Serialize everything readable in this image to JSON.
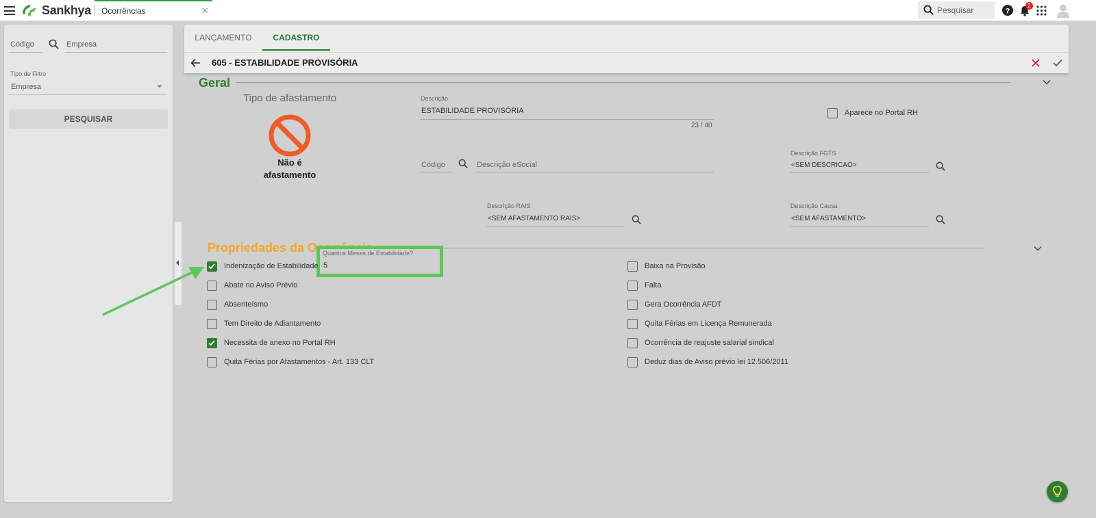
{
  "app": {
    "brand": "Sankhya",
    "tab_title": "Ocorrências",
    "search_placeholder": "Pesquisar",
    "notification_count": "2"
  },
  "left_panel": {
    "codigo_label": "Código",
    "empresa_label": "Empresa",
    "tipo_filtro_label": "Tipo de Filtro",
    "tipo_filtro_value": "Empresa",
    "pesquisar_label": "PESQUISAR"
  },
  "tabs": [
    {
      "label": "LANÇAMENTO"
    },
    {
      "label": "CADASTRO"
    }
  ],
  "record_title": "605 - ESTABILIDADE PROVISÓRIA",
  "geral": {
    "section_title": "Geral",
    "tipo_afastamento_label": "Tipo de afastamento",
    "tipo_afastamento_value_line1": "Não é",
    "tipo_afastamento_value_line2": "afastamento",
    "descricao_label": "Descrição",
    "descricao_value": "ESTABILIDADE PROVISÓRIA",
    "descricao_counter": "23 / 40",
    "aparece_portal_label": "Aparece no Portal RH",
    "codigo_label": "Código",
    "descricao_esocial_label": "Descrição eSocial",
    "descricao_fgts_label": "Descrição FGTS",
    "descricao_fgts_value": "<SEM DESCRICAO>",
    "descricao_rais_label": "Descrição RAIS",
    "descricao_rais_value": "<SEM AFASTAMENTO RAIS>",
    "descricao_causa_label": "Descrição Causa",
    "descricao_causa_value": "<SEM AFASTAMENTO>"
  },
  "propriedades": {
    "section_title": "Propriedades da Ocorrência",
    "meses_label": "Quantos Meses de Estabilidade?",
    "meses_value": "5",
    "left_checks": [
      {
        "label": "Indenização de Estabilidade",
        "checked": true
      },
      {
        "label": "Abate no Aviso Prévio",
        "checked": false
      },
      {
        "label": "Absenteísmo",
        "checked": false
      },
      {
        "label": "Tem Direito de Adiantamento",
        "checked": false
      },
      {
        "label": "Necessita de anexo no Portal RH",
        "checked": true
      },
      {
        "label": "Quita Férias por Afastamentos - Art. 133 CLT",
        "checked": false
      }
    ],
    "right_checks": [
      {
        "label": "Baixa na Provisão",
        "checked": false
      },
      {
        "label": "Falta",
        "checked": false
      },
      {
        "label": "Gera Ocorrência AFDT",
        "checked": false
      },
      {
        "label": "Quita Férias em Licença Remunerada",
        "checked": false
      },
      {
        "label": "Ocorrência de reajuste salarial sindical",
        "checked": false
      },
      {
        "label": "Deduz dias de Aviso prévio lei 12.506/2011",
        "checked": false
      }
    ]
  },
  "colors": {
    "brand_green": "#2e9e3e",
    "section_green": "#2e7d32",
    "section_orange": "#f5a623",
    "highlight_green": "#5cc85c",
    "cancel_red": "#e02020",
    "forbidden_orange": "#f15a29"
  }
}
